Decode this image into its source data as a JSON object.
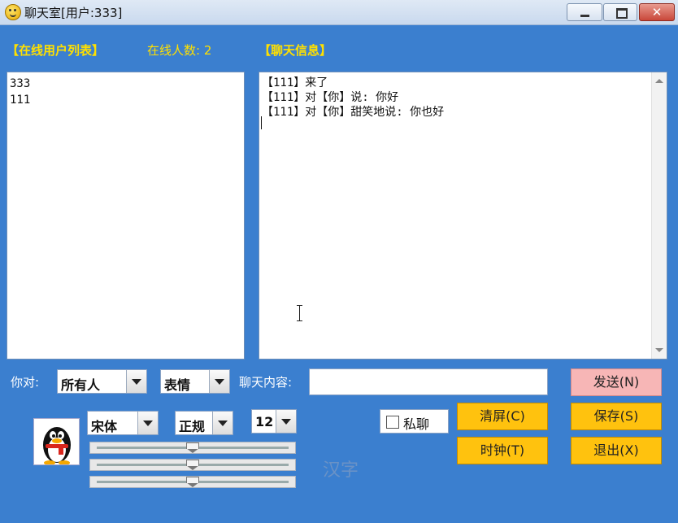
{
  "window": {
    "title": "聊天室[用户:333]"
  },
  "labels": {
    "online_list": "【在线用户列表】",
    "online_count": "在线人数: 2",
    "chat_info": "【聊天信息】",
    "to_label": "你对:",
    "content_label": "聊天内容:"
  },
  "users": [
    "333",
    "111"
  ],
  "messages": [
    "【111】来了",
    "【111】对【你】说: 你好",
    "【111】对【你】甜笑地说: 你也好"
  ],
  "controls": {
    "recipient": "所有人",
    "expression": "表情",
    "font": "宋体",
    "style": "正规",
    "size": "12",
    "message_input": "",
    "private_label": "私聊",
    "private_checked": false
  },
  "buttons": {
    "send": "发送(N)",
    "clear": "清屏(C)",
    "save": "保存(S)",
    "clock": "时钟(T)",
    "exit": "退出(X)"
  },
  "sliders": [
    {
      "name": "red",
      "value": 0.5
    },
    {
      "name": "green",
      "value": 0.5
    },
    {
      "name": "blue",
      "value": 0.5
    }
  ],
  "preview_text": "汉字",
  "colors": {
    "background": "#3b7fcf",
    "label_yellow": "#ffe000",
    "button_yellow": "#ffc20e",
    "send_button": "#f7b6b6",
    "preview": "#6a92c6"
  }
}
